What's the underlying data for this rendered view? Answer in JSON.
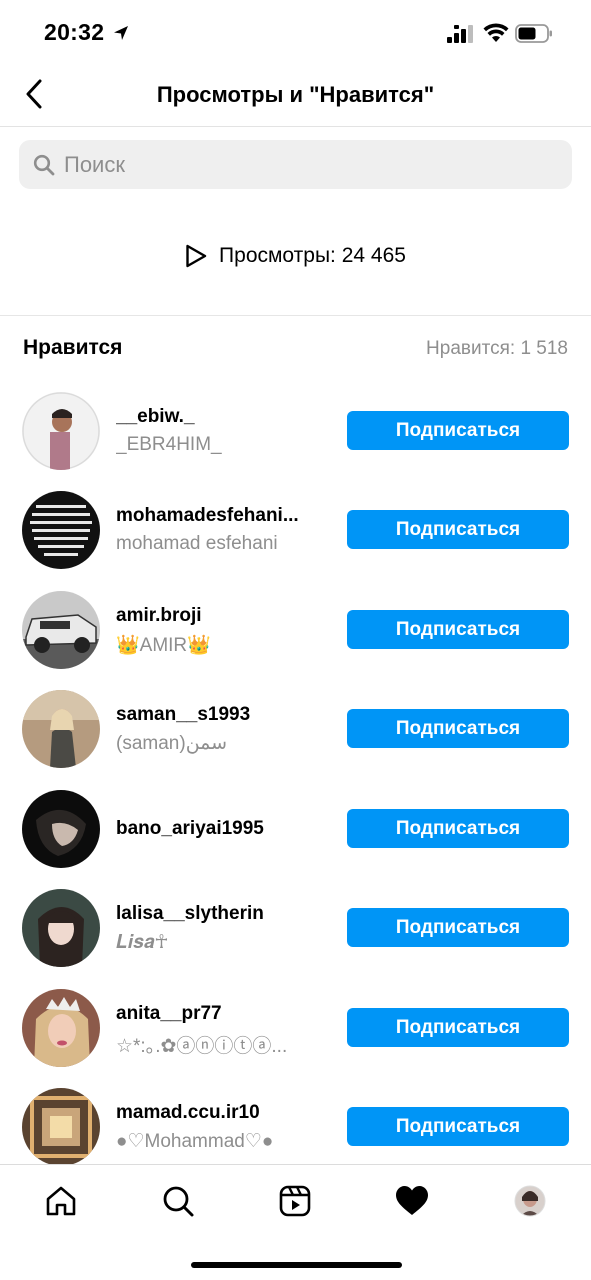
{
  "status_bar": {
    "time": "20:32"
  },
  "header": {
    "title": "Просмотры и \"Нравится\""
  },
  "search": {
    "placeholder": "Поиск"
  },
  "views": {
    "label": "Просмотры: 24 465"
  },
  "likes": {
    "title": "Нравится",
    "count": "Нравится: 1 518"
  },
  "users": [
    {
      "username": "__ebiw._",
      "fullname": "_EBR4HIM_",
      "button": "Подписаться"
    },
    {
      "username": "mohamadesfehani...",
      "fullname": "mohamad esfehani",
      "button": "Подписаться"
    },
    {
      "username": "amir.broji",
      "fullname": "👑AMIR👑",
      "button": "Подписаться"
    },
    {
      "username": "saman__s1993",
      "fullname": "(saman)سمن",
      "button": "Подписаться"
    },
    {
      "username": "bano_ariyai1995",
      "fullname": "",
      "button": "Подписаться"
    },
    {
      "username": "lalisa__slytherin",
      "fullname": "𝑳𝒊𝒔𝒂☥",
      "button": "Подписаться"
    },
    {
      "username": "anita__pr77",
      "fullname": "☆*:｡.✿ⓐⓝⓘⓣⓐ...",
      "button": "Подписаться"
    },
    {
      "username": "mamad.ccu.ir10",
      "fullname": "●♡Mohammad♡●",
      "button": "Подписаться"
    }
  ],
  "colors": {
    "accent": "#0095f6",
    "secondary_text": "#8e8e8e",
    "search_bg": "#efefef"
  },
  "tab_icons": [
    "home-icon",
    "search-icon",
    "reels-icon",
    "heart-icon",
    "profile-avatar"
  ]
}
